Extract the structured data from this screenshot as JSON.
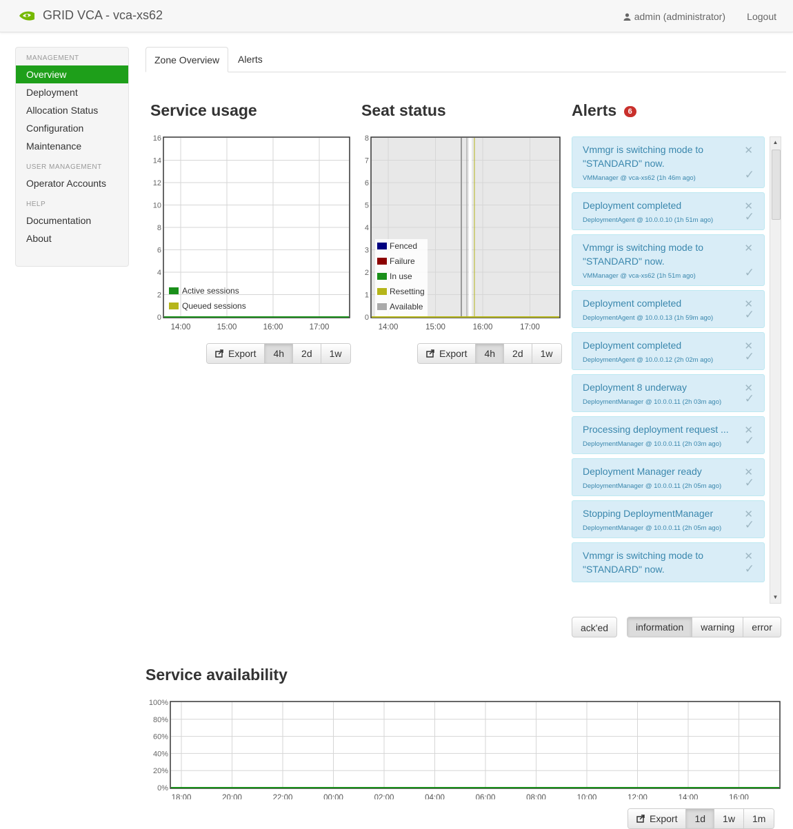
{
  "app": {
    "title": "GRID VCA - vca-xs62",
    "user": "admin (administrator)",
    "logout": "Logout"
  },
  "sidebar": {
    "sections": [
      {
        "header": "MANAGEMENT",
        "items": [
          "Overview",
          "Deployment",
          "Allocation Status",
          "Configuration",
          "Maintenance"
        ]
      },
      {
        "header": "USER MANAGEMENT",
        "items": [
          "Operator Accounts"
        ]
      },
      {
        "header": "HELP",
        "items": [
          "Documentation",
          "About"
        ]
      }
    ],
    "active": "Overview"
  },
  "tabs": [
    "Zone Overview",
    "Alerts"
  ],
  "service_usage": {
    "title": "Service usage",
    "yticks": [
      "0",
      "2",
      "4",
      "6",
      "8",
      "10",
      "12",
      "14",
      "16"
    ],
    "xticks": [
      "14:00",
      "15:00",
      "16:00",
      "17:00"
    ],
    "legend": [
      "Active sessions",
      "Queued sessions"
    ],
    "buttons": {
      "export": "Export",
      "ranges": [
        "4h",
        "2d",
        "1w"
      ]
    }
  },
  "seat_status": {
    "title": "Seat status",
    "yticks": [
      "0",
      "1",
      "2",
      "3",
      "4",
      "5",
      "6",
      "7",
      "8"
    ],
    "xticks": [
      "14:00",
      "15:00",
      "16:00",
      "17:00"
    ],
    "legend": [
      "Fenced",
      "Failure",
      "In use",
      "Resetting",
      "Available"
    ],
    "buttons": {
      "export": "Export",
      "ranges": [
        "4h",
        "2d",
        "1w"
      ]
    }
  },
  "alerts_panel": {
    "title": "Alerts",
    "count": "6",
    "items": [
      {
        "msg": "Vmmgr is switching mode to \"STANDARD\" now.",
        "src": "VMManager @ vca-xs62  (1h 46m ago)"
      },
      {
        "msg": "Deployment completed",
        "src": "DeploymentAgent @ 10.0.0.10  (1h 51m ago)"
      },
      {
        "msg": "Vmmgr is switching mode to \"STANDARD\" now.",
        "src": "VMManager @ vca-xs62  (1h 51m ago)"
      },
      {
        "msg": "Deployment completed",
        "src": "DeploymentAgent @ 10.0.0.13  (1h 59m ago)"
      },
      {
        "msg": "Deployment completed",
        "src": "DeploymentAgent @ 10.0.0.12  (2h 02m ago)"
      },
      {
        "msg": "Deployment 8 underway",
        "src": "DeploymentManager @ 10.0.0.11  (2h 03m ago)"
      },
      {
        "msg": "Processing deployment request ...",
        "src": "DeploymentManager @ 10.0.0.11  (2h 03m ago)"
      },
      {
        "msg": "Deployment Manager ready",
        "src": "DeploymentManager @ 10.0.0.11  (2h 05m ago)"
      },
      {
        "msg": "Stopping DeploymentManager",
        "src": "DeploymentManager @ 10.0.0.11  (2h 05m ago)"
      },
      {
        "msg": "Vmmgr is switching mode to \"STANDARD\" now.",
        "src": ""
      }
    ],
    "filters": {
      "acked": "ack'ed",
      "levels": [
        "information",
        "warning",
        "error"
      ]
    }
  },
  "service_availability": {
    "title": "Service availability",
    "yticks": [
      "0%",
      "20%",
      "40%",
      "60%",
      "80%",
      "100%"
    ],
    "xticks": [
      "18:00",
      "20:00",
      "22:00",
      "00:00",
      "02:00",
      "04:00",
      "06:00",
      "08:00",
      "10:00",
      "12:00",
      "14:00",
      "16:00"
    ],
    "buttons": {
      "export": "Export",
      "ranges": [
        "1d",
        "1w",
        "1m"
      ]
    }
  },
  "colors": {
    "accent": "#1e9f1a",
    "fenced": "#000080",
    "failure": "#8b0000",
    "in_use": "#1a8f1a",
    "resetting": "#b5b51a",
    "available": "#a9a9a9",
    "active_sessions": "#1a8f1a",
    "queued_sessions": "#b5b51a"
  },
  "chart_data": [
    {
      "type": "line",
      "title": "Service usage",
      "x": [
        "14:00",
        "15:00",
        "16:00",
        "17:00"
      ],
      "ylim": [
        0,
        16
      ],
      "series": [
        {
          "name": "Active sessions",
          "values": [
            0,
            0,
            0,
            0
          ]
        },
        {
          "name": "Queued sessions",
          "values": [
            0,
            0,
            0,
            0
          ]
        }
      ]
    },
    {
      "type": "area",
      "title": "Seat status",
      "x": [
        "14:00",
        "15:00",
        "16:00",
        "17:00"
      ],
      "ylim": [
        0,
        8
      ],
      "series": [
        {
          "name": "Fenced",
          "values": [
            0,
            0,
            0,
            0
          ]
        },
        {
          "name": "Failure",
          "values": [
            0,
            0,
            0,
            0
          ]
        },
        {
          "name": "In use",
          "values": [
            0,
            0,
            0,
            0
          ]
        },
        {
          "name": "Resetting",
          "values": [
            0,
            0,
            0,
            0
          ]
        },
        {
          "name": "Available",
          "values": [
            8,
            8,
            8,
            8
          ]
        }
      ]
    },
    {
      "type": "line",
      "title": "Service availability",
      "x": [
        "18:00",
        "20:00",
        "22:00",
        "00:00",
        "02:00",
        "04:00",
        "06:00",
        "08:00",
        "10:00",
        "12:00",
        "14:00",
        "16:00"
      ],
      "ylim": [
        0,
        100
      ],
      "series": [
        {
          "name": "",
          "values": [
            0,
            0,
            0,
            0,
            0,
            0,
            0,
            0,
            0,
            0,
            0,
            0
          ]
        }
      ]
    }
  ]
}
